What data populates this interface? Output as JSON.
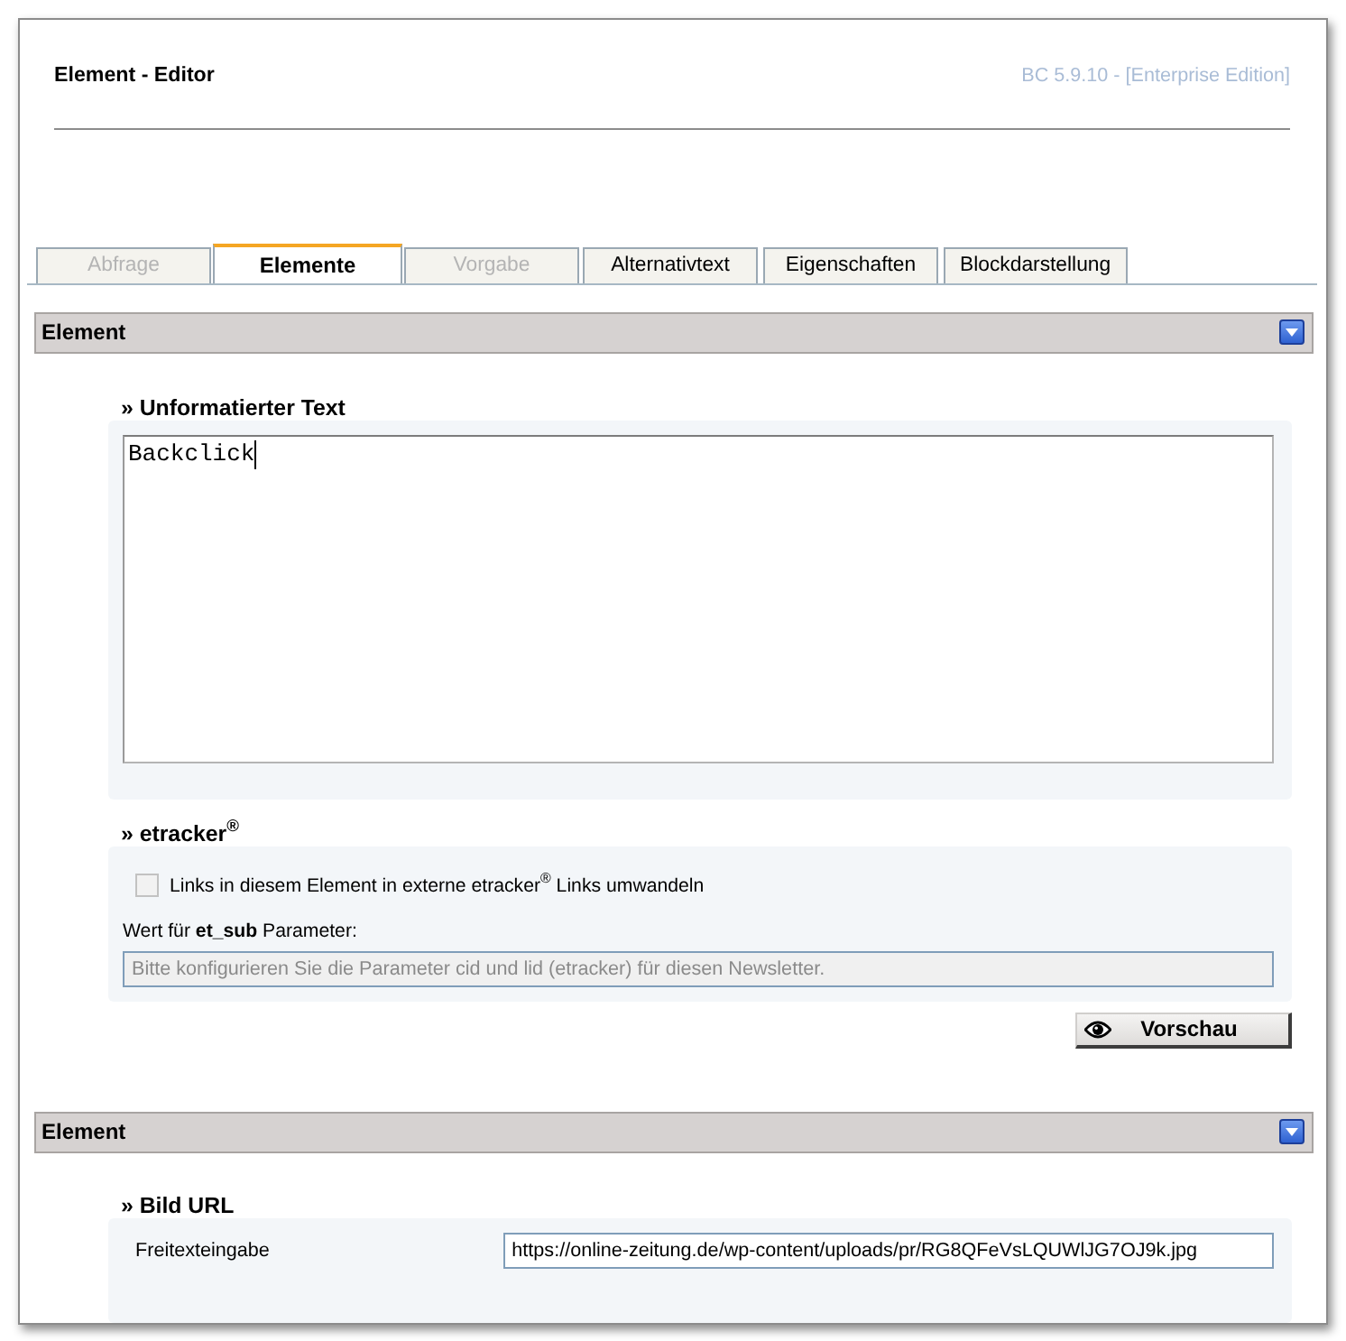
{
  "window": {
    "title": "Element - Editor",
    "version": "BC 5.9.10 - [Enterprise Edition]"
  },
  "tabs": [
    {
      "label": "Abfrage",
      "selected": false,
      "disabled": true
    },
    {
      "label": "Elemente",
      "selected": true,
      "disabled": false
    },
    {
      "label": "Vorgabe",
      "selected": false,
      "disabled": true
    },
    {
      "label": "Alternativtext",
      "selected": false,
      "disabled": false
    },
    {
      "label": "Eigenschaften",
      "selected": false,
      "disabled": false
    },
    {
      "label": "Blockdarstellung",
      "selected": false,
      "disabled": false
    }
  ],
  "sections": [
    {
      "title": "Element",
      "groups": [
        {
          "kind": "textarea",
          "title": "» Unformatierter Text",
          "value": "Backclick",
          "focused": true
        },
        {
          "kind": "tracking",
          "title": "» etracker$^{®}$",
          "checkbox": {
            "label": "Links in diesem Element in externe etracker$^{®}$ Links umwandeln",
            "checked": false
          },
          "field_label": "Wert für **et_sub** Parameter:",
          "field": {
            "placeholder": "Bitte konfigurieren Sie die Parameter cid und lid (etracker) für diesen Newsletter.",
            "disabled": true
          }
        }
      ],
      "button": {
        "label": "Vorschau"
      }
    },
    {
      "title": "Element",
      "groups": [
        {
          "kind": "url",
          "title": "» Bild URL",
          "label": "Freitexteingabe",
          "value": "https://online-zeitung.de/wp-content/uploads/pr/RG8QFeVsLQUWlJG7OJ9k.jpg"
        }
      ]
    }
  ]
}
